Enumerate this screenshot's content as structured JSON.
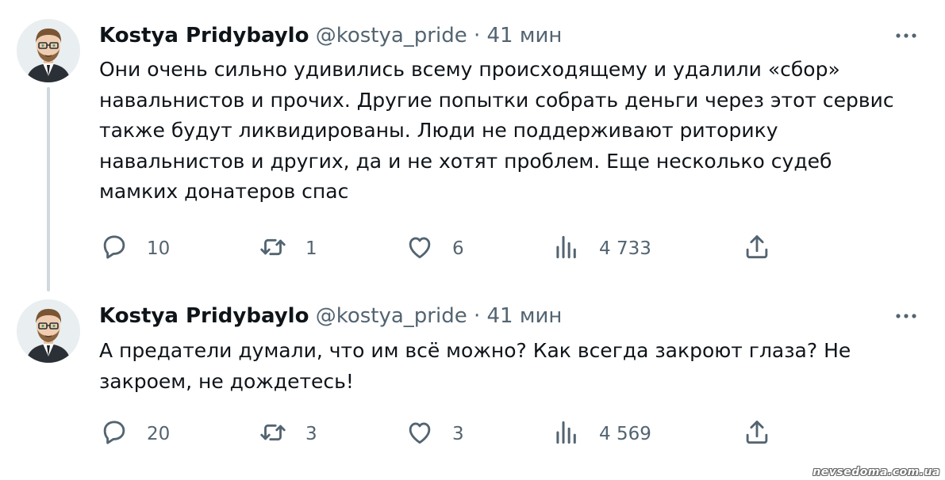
{
  "tweets": [
    {
      "author_name": "Kostya Pridybaylo",
      "author_handle": "@kostya_pride",
      "separator": "·",
      "time": "41 мин",
      "text": "Они очень сильно удивились всему происходящему и удалили «сбор»\nнавальнистов и прочих. Другие попытки собрать деньги через этот сервис\nтакже будут ликвидированы. Люди не поддерживают риторику\nнавальнистов и других, да и не хотят проблем. Еще несколько судеб\nмамких донатеров спас",
      "replies": "10",
      "retweets": "1",
      "likes": "6",
      "views": "4 733"
    },
    {
      "author_name": "Kostya Pridybaylo",
      "author_handle": "@kostya_pride",
      "separator": "·",
      "time": "41 мин",
      "text": "А предатели думали, что им всё можно? Как всегда закроют глаза? Не\nзакроем, не дождетесь!",
      "replies": "20",
      "retweets": "3",
      "likes": "3",
      "views": "4 569"
    }
  ],
  "icons": {
    "reply": "reply-icon",
    "retweet": "retweet-icon",
    "like": "heart-icon",
    "views": "views-icon",
    "share": "share-icon",
    "more": "more-icon"
  },
  "colors": {
    "text": "#0f1419",
    "secondary": "#536471",
    "thread_line": "#cfd9de"
  },
  "watermark": "nevsedoma.com.ua"
}
